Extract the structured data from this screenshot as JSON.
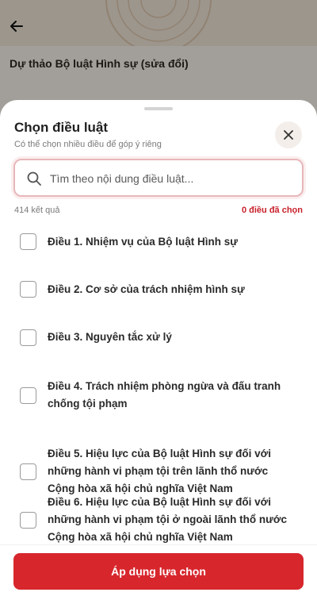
{
  "background": {
    "title": "Dự thảo Bộ luật Hình sự (sửa đổi)"
  },
  "sheet": {
    "title": "Chọn điều luật",
    "subtitle": "Có thể chọn nhiều điều để góp ý riêng",
    "search_placeholder": "Tìm theo nội dung điều luật...",
    "result_count": "414 kết quả",
    "selected_count": "0 điều đã chọn",
    "items": [
      {
        "label": "Điều 1. Nhiệm vụ của Bộ luật Hình sự",
        "checked": false
      },
      {
        "label": "Điều 2. Cơ sở của trách nhiệm hình sự",
        "checked": false
      },
      {
        "label": "Điều 3. Nguyên tắc xử lý",
        "checked": false
      },
      {
        "label": "Điều 4. Trách nhiệm phòng ngừa và đấu tranh chống tội phạm",
        "checked": false
      },
      {
        "label": "Điều 5. Hiệu lực của Bộ luật Hình sự đối với những hành vi phạm tội trên lãnh thổ nước Cộng hòa xã hội chủ nghĩa Việt Nam",
        "checked": false
      },
      {
        "label": "Điều 6. Hiệu lực của Bộ luật Hình sự đối với những hành vi phạm tội ở ngoài lãnh thổ nước Cộng hòa xã hội chủ nghĩa Việt Nam",
        "checked": false
      }
    ],
    "apply_label": "Áp dụng lựa chọn"
  },
  "colors": {
    "accent": "#d7262c",
    "search_border": "#e7b7b9",
    "selected_text": "#c8202a"
  },
  "icons": {
    "back": "arrow-left-icon",
    "close": "close-icon",
    "search": "search-icon"
  }
}
